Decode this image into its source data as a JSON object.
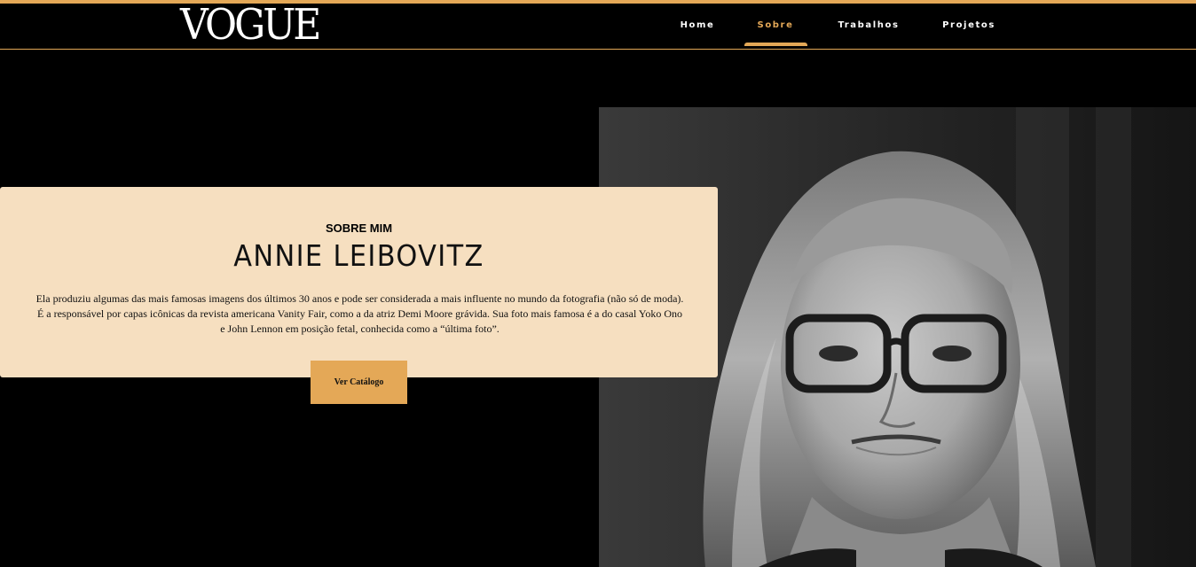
{
  "brand": {
    "logo": "VOGUE",
    "accent": "#e4a857",
    "card_bg": "#f6dfc0"
  },
  "nav": {
    "items": [
      {
        "label": "Home",
        "active": false
      },
      {
        "label": "Sobre",
        "active": true
      },
      {
        "label": "Trabalhos",
        "active": false
      },
      {
        "label": "Projetos",
        "active": false
      }
    ]
  },
  "about": {
    "subtitle": "SOBRE MIM",
    "name": "ANNIE LEIBOVITZ",
    "bio": "Ela produziu algumas das mais famosas imagens dos últimos 30 anos e pode ser considerada a mais influente no mundo da fotografia (não só de moda). É a responsável por capas icônicas da revista americana Vanity Fair, como a da atriz Demi Moore grávida. Sua foto mais famosa é a do casal Yoko Ono e John Lennon em posição fetal, conhecida como a “última foto”.",
    "cta_label": "Ver Catálogo"
  },
  "photo": {
    "icon": "portrait-photo"
  }
}
